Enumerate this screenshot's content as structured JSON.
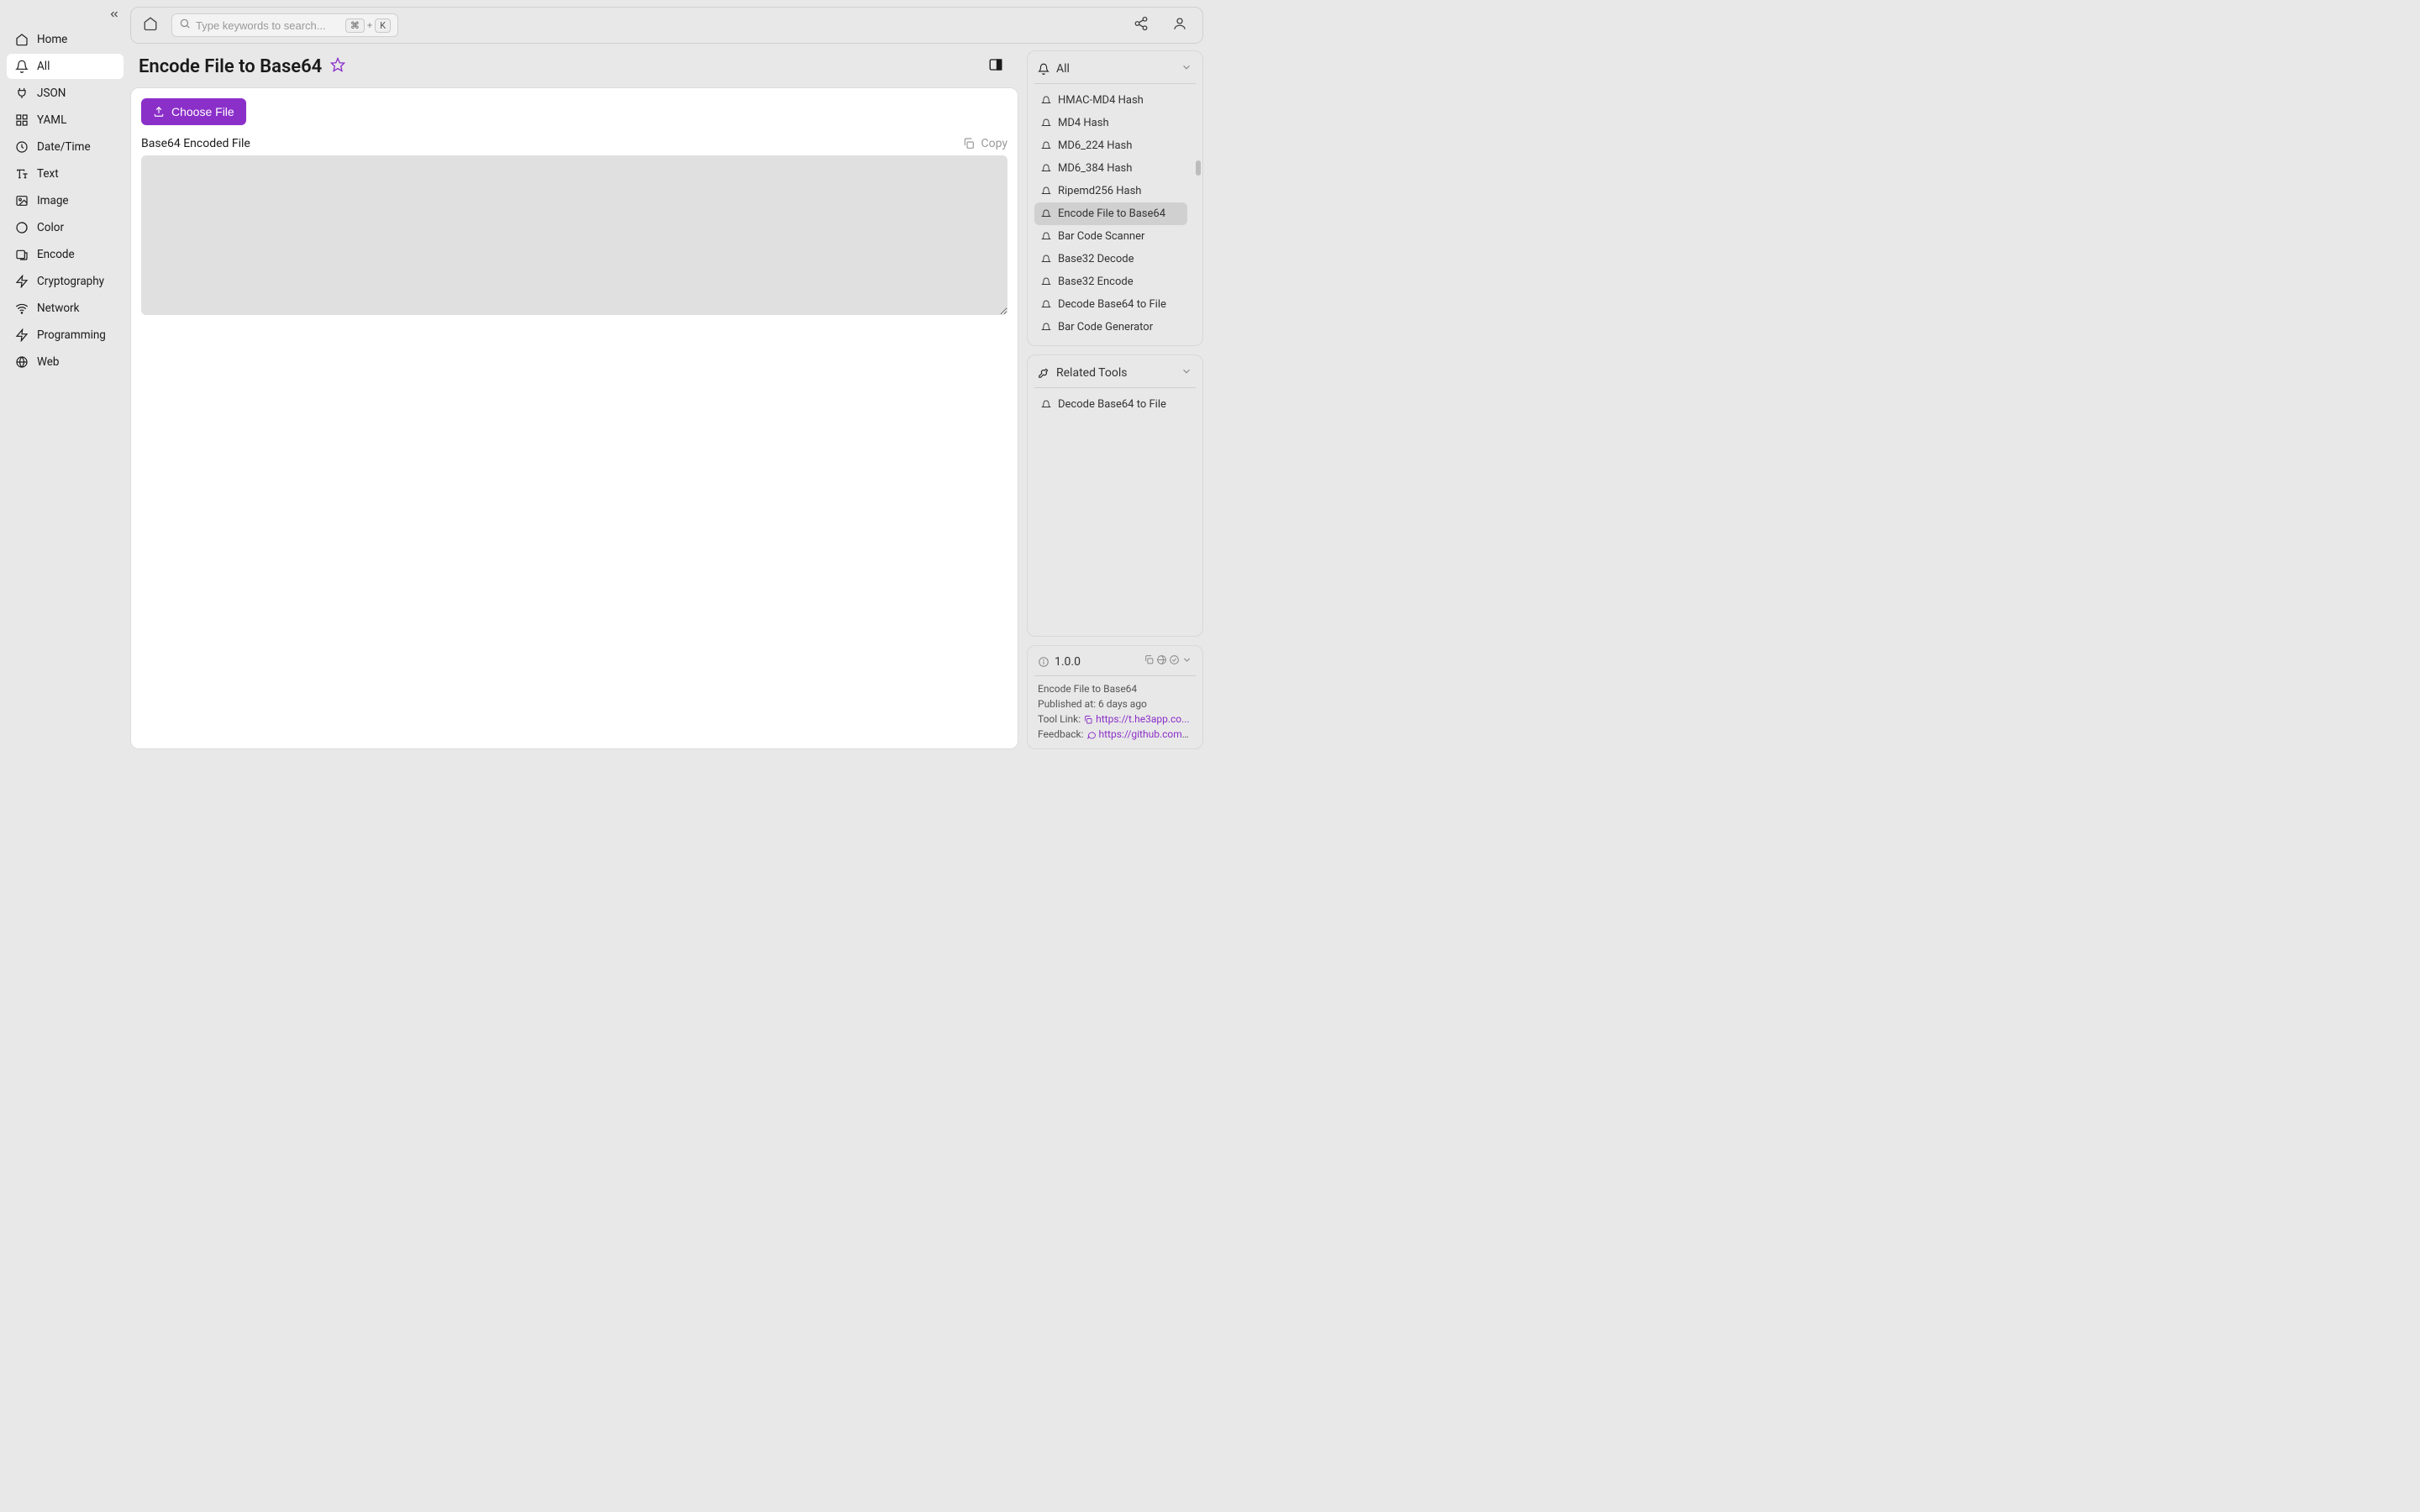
{
  "sidebar": {
    "items": [
      {
        "label": "Home"
      },
      {
        "label": "All"
      },
      {
        "label": "JSON"
      },
      {
        "label": "YAML"
      },
      {
        "label": "Date/Time"
      },
      {
        "label": "Text"
      },
      {
        "label": "Image"
      },
      {
        "label": "Color"
      },
      {
        "label": "Encode"
      },
      {
        "label": "Cryptography"
      },
      {
        "label": "Network"
      },
      {
        "label": "Programming"
      },
      {
        "label": "Web"
      }
    ]
  },
  "search": {
    "placeholder": "Type keywords to search...",
    "shortcut_mod": "⌘",
    "shortcut_plus": "+",
    "shortcut_key": "K"
  },
  "page": {
    "title": "Encode File to Base64",
    "choose_label": "Choose File",
    "output_label": "Base64 Encoded File",
    "copy_label": "Copy"
  },
  "right": {
    "all_label": "All",
    "tools": [
      {
        "label": "HMAC-MD4 Hash"
      },
      {
        "label": "MD4 Hash"
      },
      {
        "label": "MD6_224 Hash"
      },
      {
        "label": "MD6_384 Hash"
      },
      {
        "label": "Ripemd256 Hash"
      },
      {
        "label": "Encode File to Base64"
      },
      {
        "label": "Bar Code Scanner"
      },
      {
        "label": "Base32 Decode"
      },
      {
        "label": "Base32 Encode"
      },
      {
        "label": "Decode Base64 to File"
      },
      {
        "label": "Bar Code Generator"
      }
    ],
    "related_label": "Related Tools",
    "related_items": [
      {
        "label": "Decode Base64 to File"
      }
    ]
  },
  "info": {
    "version": "1.0.0",
    "title": "Encode File to Base64",
    "published_label": "Published at:",
    "published_value": "6 days ago",
    "tool_link_label": "Tool Link:",
    "tool_link_url": "https://t.he3app.co...",
    "feedback_label": "Feedback:",
    "feedback_url": "https://github.com/..."
  }
}
